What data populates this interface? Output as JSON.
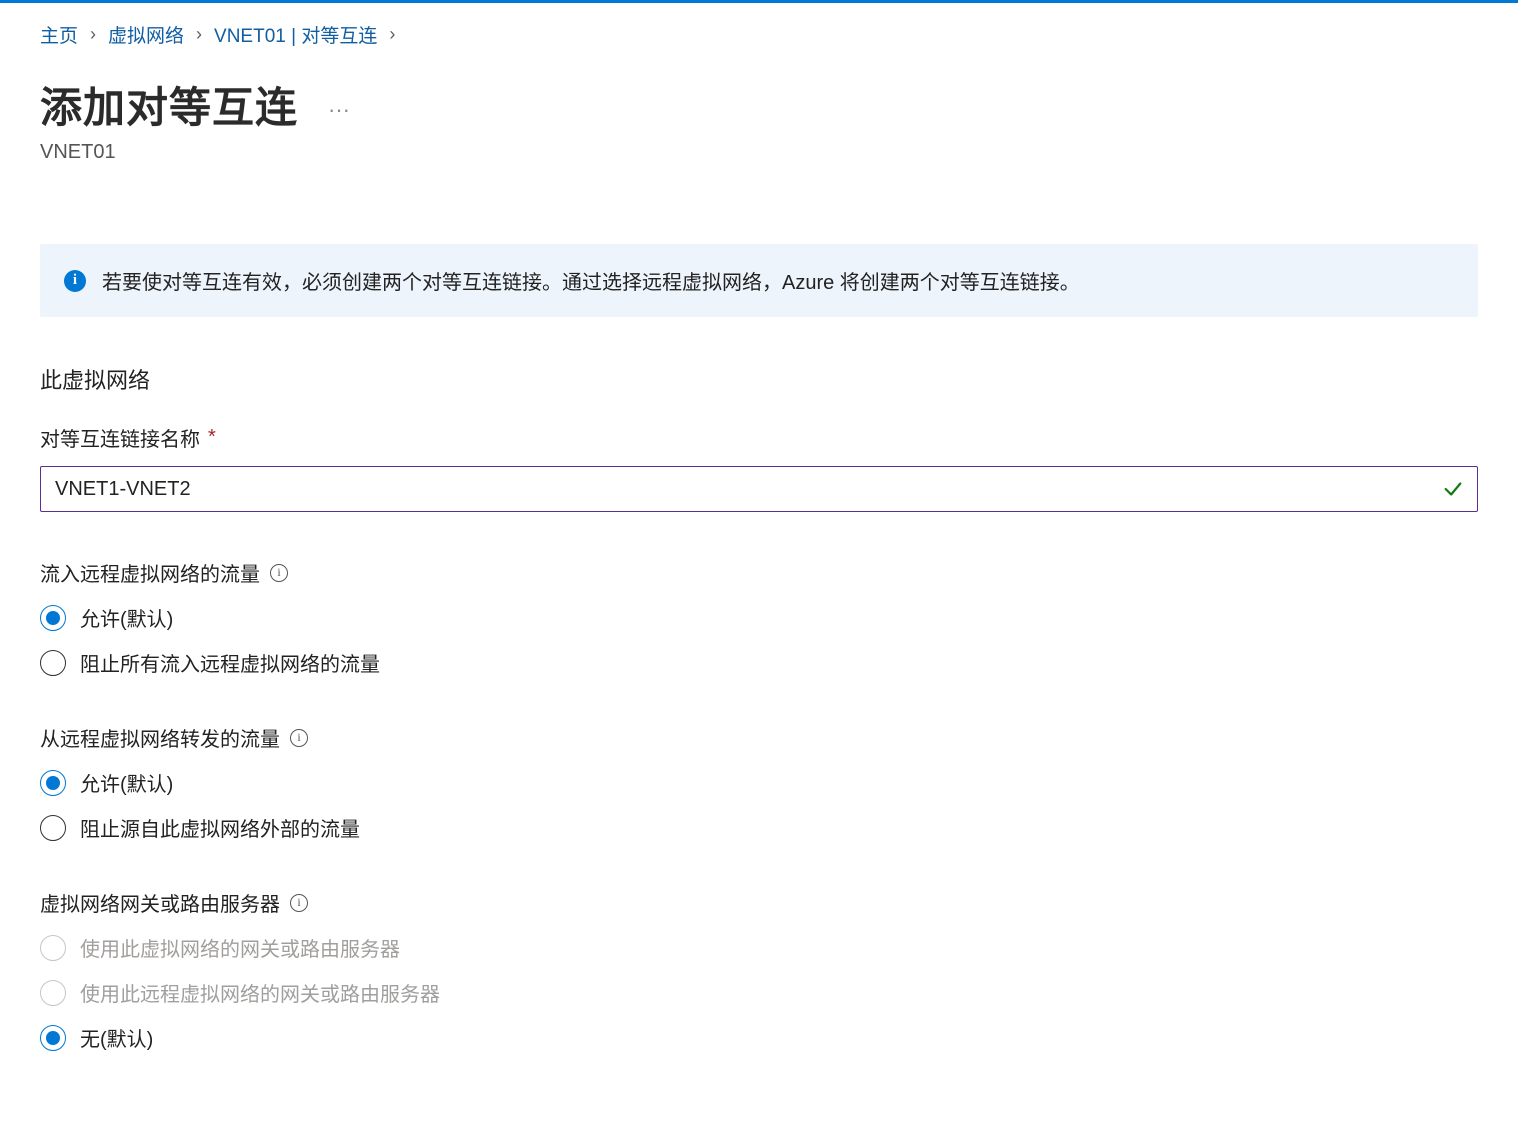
{
  "breadcrumb": {
    "home": "主页",
    "vnets": "虚拟网络",
    "peering": "VNET01 | 对等互连"
  },
  "page": {
    "title": "添加对等互连",
    "subtitle": "VNET01"
  },
  "banner": {
    "text": "若要使对等互连有效，必须创建两个对等互连链接。通过选择远程虚拟网络，Azure 将创建两个对等互连链接。"
  },
  "this_vnet": {
    "section_title": "此虚拟网络",
    "link_name_label": "对等互连链接名称",
    "link_name_value": "VNET1-VNET2",
    "traffic_to_remote": {
      "label": "流入远程虚拟网络的流量",
      "options": {
        "allow": "允许(默认)",
        "block": "阻止所有流入远程虚拟网络的流量"
      },
      "selected": "allow"
    },
    "forwarded_traffic": {
      "label": "从远程虚拟网络转发的流量",
      "options": {
        "allow": "允许(默认)",
        "block": "阻止源自此虚拟网络外部的流量"
      },
      "selected": "allow"
    },
    "gateway": {
      "label": "虚拟网络网关或路由服务器",
      "options": {
        "use_this": "使用此虚拟网络的网关或路由服务器",
        "use_remote": "使用此远程虚拟网络的网关或路由服务器",
        "none": "无(默认)"
      },
      "selected": "none",
      "disabled": [
        "use_this",
        "use_remote"
      ]
    }
  }
}
